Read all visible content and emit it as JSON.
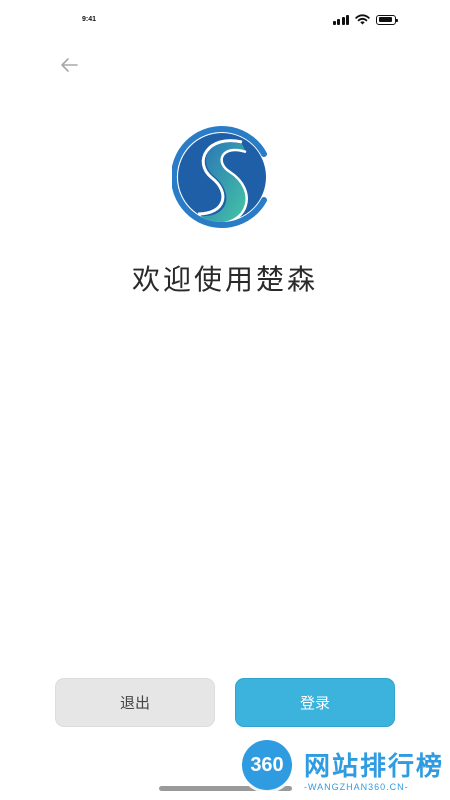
{
  "status_bar": {
    "time": "9:41",
    "icons": [
      "signal-icon",
      "wifi-icon",
      "battery-icon"
    ]
  },
  "navigation": {
    "back_icon": "arrow-left-icon"
  },
  "logo": {
    "name": "chusen-logo",
    "colors": {
      "dark_blue": "#1f5fa8",
      "ring_blue": "#2a7cc7",
      "teal": "#3fbfa5"
    }
  },
  "welcome": {
    "title": "欢迎使用楚森"
  },
  "buttons": {
    "exit_label": "退出",
    "login_label": "登录",
    "login_color": "#3bb3dc",
    "exit_color": "#e6e6e6"
  },
  "watermark": {
    "badge": "360",
    "title": "网站排行榜",
    "subtitle": "-WANGZHAN360.CN-",
    "color": "#2f9be0"
  }
}
